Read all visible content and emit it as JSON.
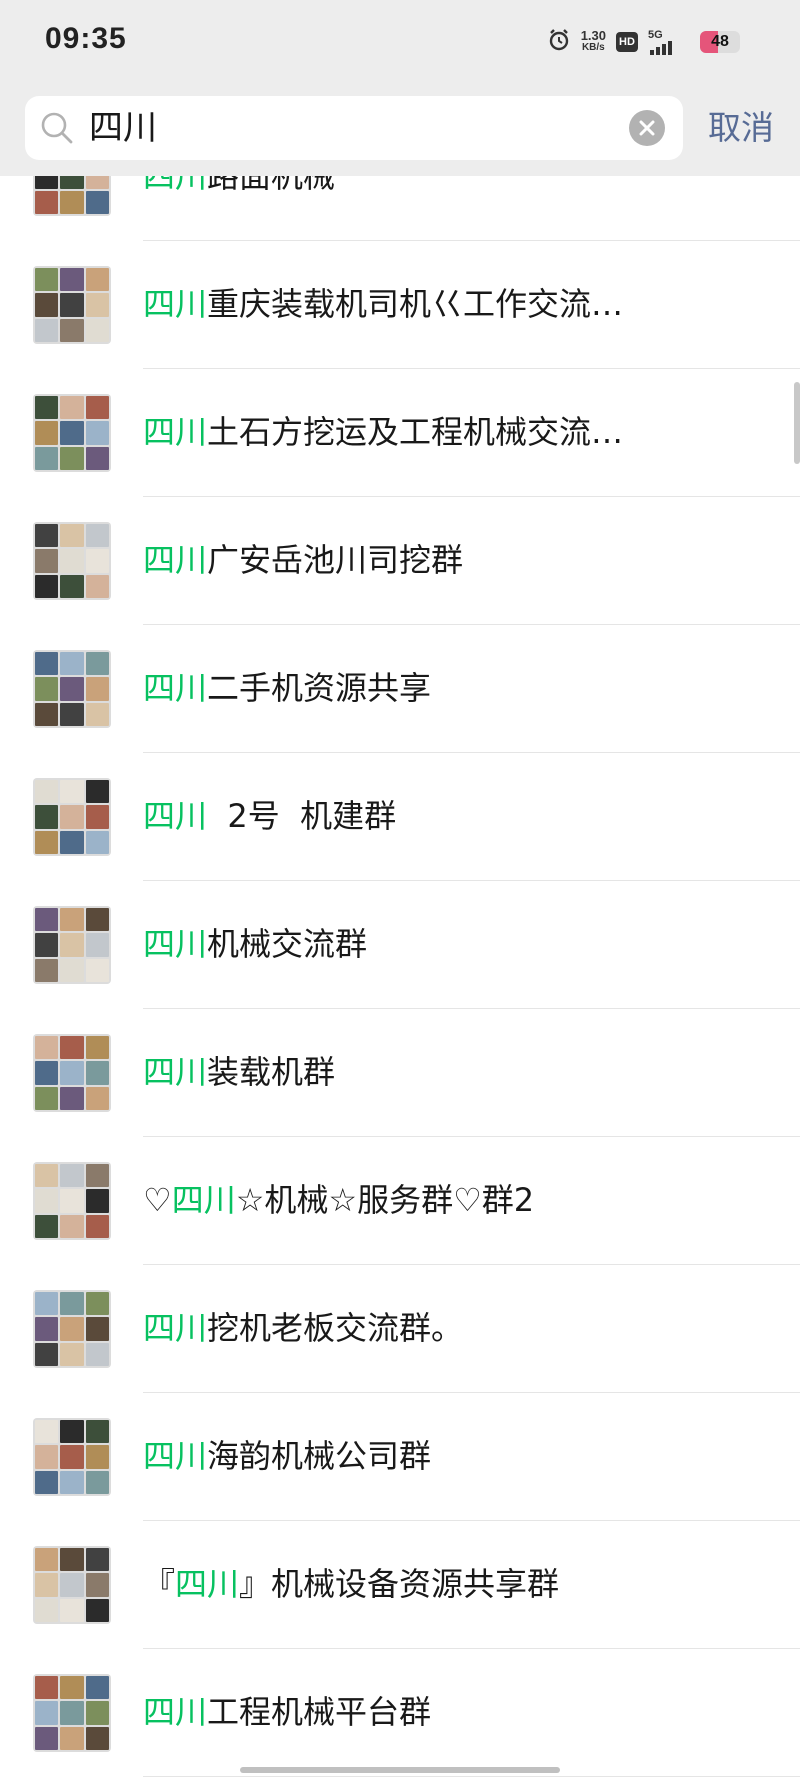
{
  "status_bar": {
    "time": "09:35",
    "net_speed_value": "1.30",
    "net_speed_unit": "KB/s",
    "hd_label": "HD",
    "network_label": "5G",
    "battery": "48",
    "icons": [
      "alarm-icon",
      "hd-icon",
      "signal-icon",
      "battery-icon"
    ]
  },
  "search": {
    "query": "四川",
    "cancel_label": "取消"
  },
  "accent_color": "#07c160",
  "link_color": "#576b95",
  "results": [
    {
      "prefix": "",
      "highlight": "四川",
      "suffix": "路面机械"
    },
    {
      "prefix": "",
      "highlight": "四川",
      "suffix": "重庆装载机司机巜工作交流…"
    },
    {
      "prefix": "",
      "highlight": "四川",
      "suffix": "土石方挖运及工程机械交流…"
    },
    {
      "prefix": "",
      "highlight": "四川",
      "suffix": "广安岳池川司挖群"
    },
    {
      "prefix": "",
      "highlight": "四川",
      "suffix": "二手机资源共享"
    },
    {
      "prefix": "",
      "highlight": "四川",
      "suffix": "  2号  机建群"
    },
    {
      "prefix": "",
      "highlight": "四川",
      "suffix": "机械交流群"
    },
    {
      "prefix": "",
      "highlight": "四川",
      "suffix": "装载机群"
    },
    {
      "prefix": "♡",
      "highlight": "四川",
      "suffix": "☆机械☆服务群♡群2"
    },
    {
      "prefix": "",
      "highlight": "四川",
      "suffix": "挖机老板交流群。"
    },
    {
      "prefix": "",
      "highlight": "四川",
      "suffix": "海韵机械公司群"
    },
    {
      "prefix": "『",
      "highlight": "四川",
      "suffix": "』机械设备资源共享群"
    },
    {
      "prefix": "",
      "highlight": "四川",
      "suffix": "工程机械平台群"
    }
  ]
}
